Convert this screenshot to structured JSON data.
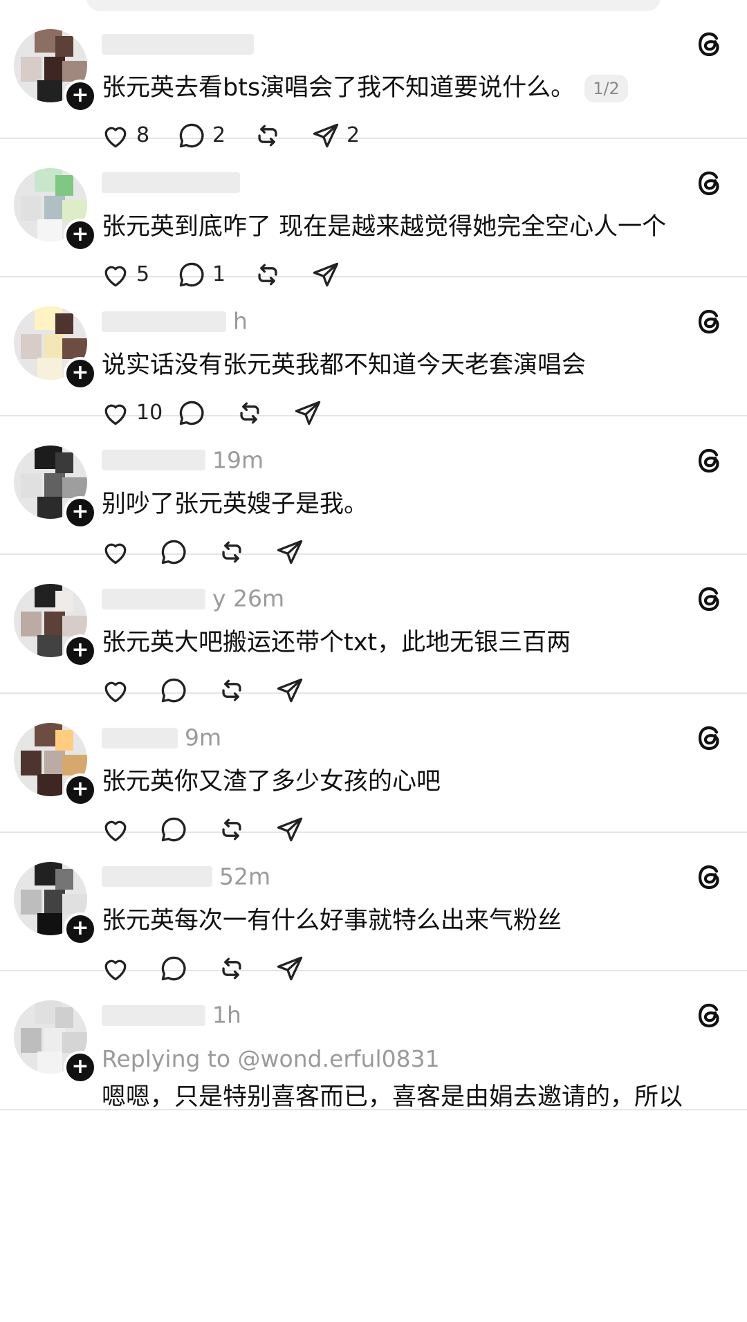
{
  "feed": {
    "posts": [
      {
        "time": "",
        "text": "张元英去看bts演唱会了我不知道要说什么。",
        "page": "1/2",
        "likes": "8",
        "replies": "2",
        "reposts": "",
        "shares": "2"
      },
      {
        "time": "",
        "text": "张元英到底咋了 现在是越来越觉得她完全空心人一个",
        "likes": "5",
        "replies": "1",
        "reposts": "",
        "shares": ""
      },
      {
        "time": "h",
        "text": "说实话没有张元英我都不知道今天老套演唱会",
        "likes": "10",
        "replies": "",
        "reposts": "",
        "shares": ""
      },
      {
        "time": "19m",
        "text": "别吵了张元英嫂子是我。",
        "likes": "",
        "replies": "",
        "reposts": "",
        "shares": ""
      },
      {
        "time": "y 26m",
        "text": "张元英大吧搬运还带个txt，此地无银三百两",
        "likes": "",
        "replies": "",
        "reposts": "",
        "shares": ""
      },
      {
        "time": "9m",
        "text": "张元英你又渣了多少女孩的心吧",
        "likes": "",
        "replies": "",
        "reposts": "",
        "shares": ""
      },
      {
        "time": "52m",
        "text": "张元英每次一有什么好事就特么出来气粉丝",
        "likes": "",
        "replies": "",
        "reposts": "",
        "shares": ""
      },
      {
        "time": "1h",
        "reply_to": "Replying to @wond.erful0831",
        "text": "嗯嗯，只是特别喜客而已，喜客是由娟去邀请的，所以",
        "likes": "",
        "replies": "",
        "reposts": "",
        "shares": ""
      }
    ]
  },
  "icons": {
    "threads": "threads-logo-icon",
    "like": "heart-icon",
    "reply": "comment-bubble-icon",
    "repost": "repost-icon",
    "share": "send-icon",
    "follow": "plus-icon"
  },
  "colors": {
    "text": "#111111",
    "muted": "#9b9b9b",
    "divider": "#e4e4e4",
    "badge_bg": "#efefef"
  }
}
